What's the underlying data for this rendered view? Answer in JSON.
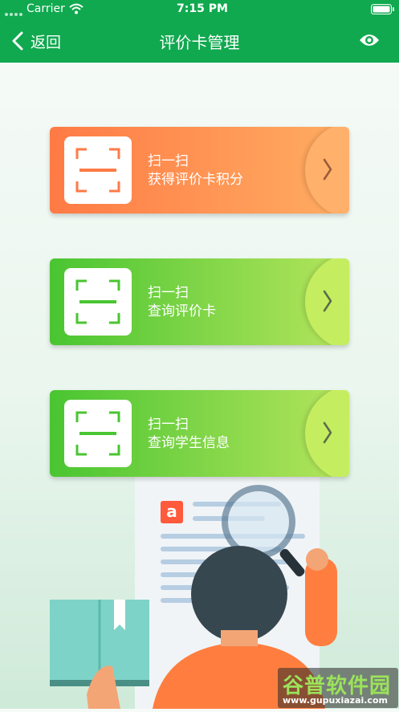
{
  "status_bar": {
    "carrier": "Carrier",
    "time": "7:15 PM"
  },
  "nav": {
    "back_label": "返回",
    "title": "评价卡管理",
    "right_icon": "eye-icon"
  },
  "cards": [
    {
      "line1": "扫一扫",
      "line2": "获得评价卡积分",
      "theme": "orange",
      "accent": "#ff7a45"
    },
    {
      "line1": "扫一扫",
      "line2": "查询评价卡",
      "theme": "green",
      "accent": "#49c531"
    },
    {
      "line1": "扫一扫",
      "line2": "查询学生信息",
      "theme": "green",
      "accent": "#49c531"
    }
  ],
  "illustration": {
    "doc_badge": "a"
  },
  "watermark": {
    "title": "谷普软件园",
    "url": "www.gupuxiazai.com"
  },
  "colors": {
    "brand_green": "#10a94f",
    "orange_start": "#ff7a45",
    "green_start": "#49c531"
  }
}
